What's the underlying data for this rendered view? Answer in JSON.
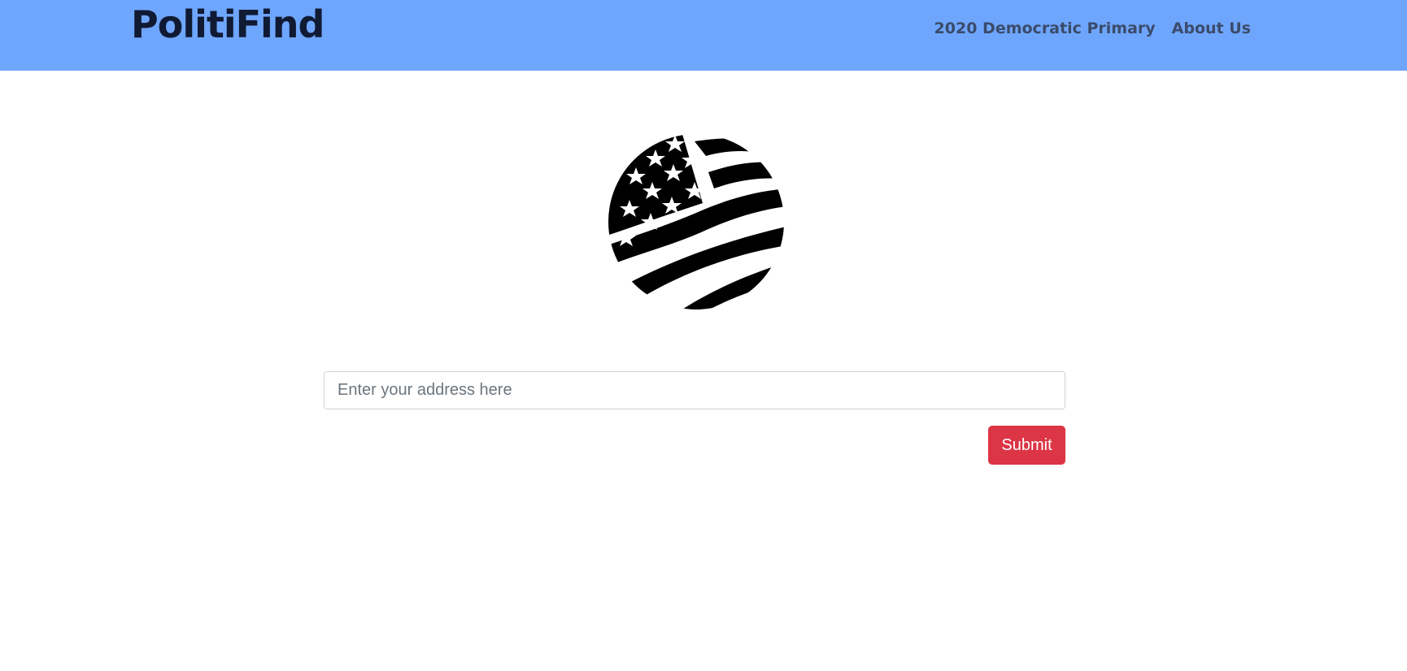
{
  "colors": {
    "navbar_bg": "#6fa6fd",
    "brand_text": "#101a33",
    "nav_link_text": "#3a4b6a",
    "submit_bg": "#dc3545",
    "submit_text": "#ffffff",
    "flag_fill": "#000000"
  },
  "navbar": {
    "brand": "PolitiFind",
    "links": [
      {
        "label": "2020 Democratic Primary"
      },
      {
        "label": "About Us"
      }
    ]
  },
  "hero": {
    "icon": "american-flag-circle-icon"
  },
  "form": {
    "address": {
      "placeholder": "Enter your address here",
      "value": ""
    },
    "submit_label": "Submit"
  }
}
